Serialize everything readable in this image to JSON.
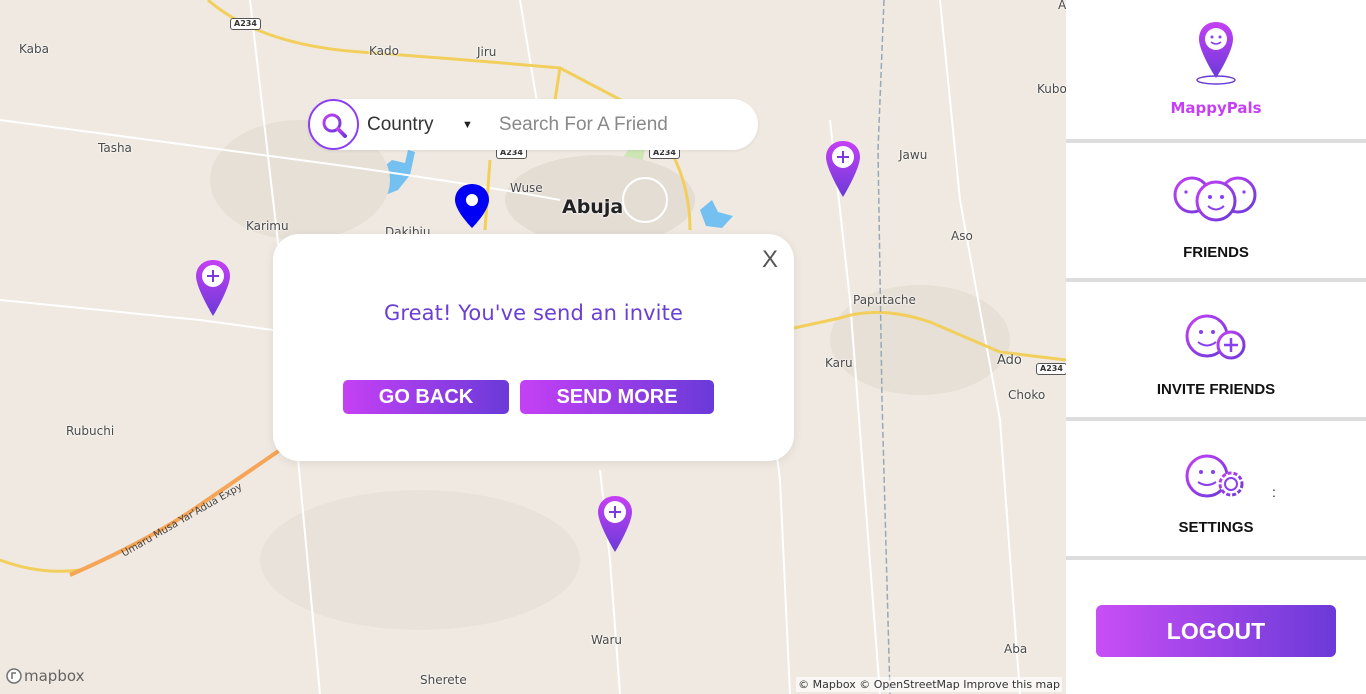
{
  "map": {
    "places": [
      {
        "name": "Kaba"
      },
      {
        "name": "Kado"
      },
      {
        "name": "Jiru"
      },
      {
        "name": "Tasha"
      },
      {
        "name": "Wuse"
      },
      {
        "name": "Abuja"
      },
      {
        "name": "Karimu"
      },
      {
        "name": "Dakibiu"
      },
      {
        "name": "Jawu"
      },
      {
        "name": "Aso"
      },
      {
        "name": "Paputache"
      },
      {
        "name": "Karu"
      },
      {
        "name": "Ado"
      },
      {
        "name": "Choko"
      },
      {
        "name": "Rubuchi"
      },
      {
        "name": "Waru"
      },
      {
        "name": "Aba"
      },
      {
        "name": "Sherete"
      },
      {
        "name": "Kubo"
      },
      {
        "name": "A"
      }
    ],
    "road_shields": [
      "A234",
      "A234",
      "A234",
      "A234"
    ],
    "road_label": "Umaru Musa Yar'Adua Expy",
    "logo": "mapbox",
    "attribution": "© Mapbox © OpenStreetMap  Improve this map"
  },
  "search": {
    "country_label": "Country",
    "caret": "▼",
    "placeholder": "Search For A Friend",
    "icon": "search-icon"
  },
  "modal": {
    "close": "X",
    "message": "Great! You've send an invite",
    "go_back": "GO BACK",
    "send_more": "SEND MORE"
  },
  "sidebar": {
    "brand": "MappyPals",
    "items": [
      {
        "label": "FRIENDS",
        "icon": "friends-icon"
      },
      {
        "label": "INVITE FRIENDS",
        "icon": "invite-friends-icon"
      },
      {
        "label": "SETTINGS",
        "icon": "settings-icon"
      }
    ],
    "settings_colon": ":",
    "logout": "LOGOUT"
  },
  "colors": {
    "accent_start": "#c540f5",
    "accent_end": "#6a3ad8",
    "pin_blue": "#0000ff",
    "brand_text": "#c540f5"
  }
}
